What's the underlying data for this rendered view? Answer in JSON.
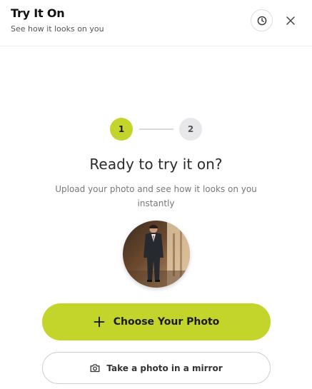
{
  "header": {
    "title": "Try It On",
    "subtitle": "See how it looks on you",
    "history_icon": "clock-icon",
    "close_icon": "close-icon"
  },
  "stepper": {
    "steps": [
      "1",
      "2"
    ],
    "current_step": 1,
    "active_color": "#c3d52a",
    "inactive_color": "#e8e8ea"
  },
  "main": {
    "heading": "Ready to try it on?",
    "description": "Upload your photo and see how it looks on you instantly",
    "preview_image": "man-in-dark-suit-photo"
  },
  "actions": {
    "primary_label": "Choose Your Photo",
    "primary_icon": "plus-icon",
    "primary_color": "#c3d52a",
    "secondary_label": "Take a photo in a mirror",
    "secondary_icon": "camera-icon"
  }
}
